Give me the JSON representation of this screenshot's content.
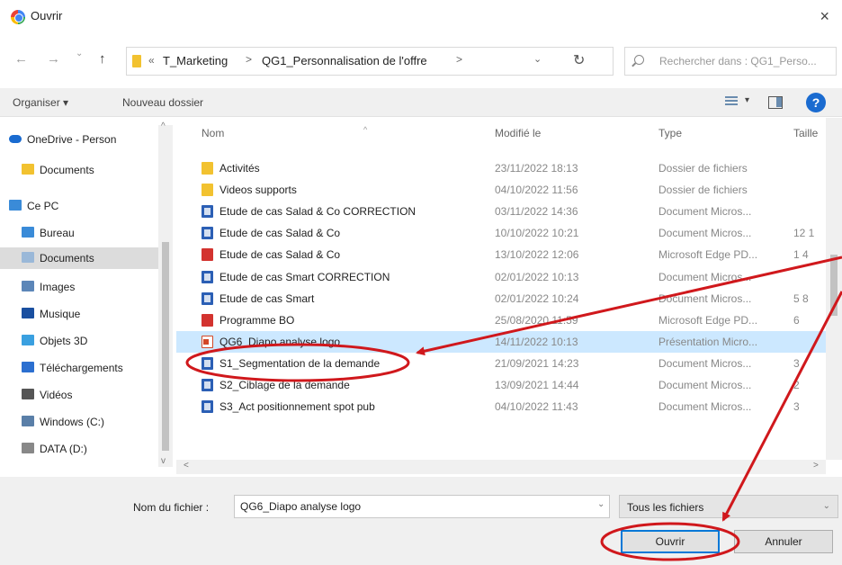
{
  "window": {
    "title": "Ouvrir",
    "close_glyph": "×"
  },
  "nav": {
    "back": "←",
    "forward": "→",
    "up": "↑",
    "breadcrumb_prefix": "«",
    "breadcrumb": [
      "T_Marketing",
      "QG1_Personnalisation de l'offre"
    ],
    "separator": ">",
    "dropdown": "⌄",
    "refresh": "↻",
    "search_placeholder": "Rechercher dans : QG1_Perso..."
  },
  "toolbar": {
    "organize": "Organiser ▾",
    "new_folder": "Nouveau dossier",
    "view_dropdown": "▾",
    "help": "?"
  },
  "sidebar": {
    "items": [
      {
        "label": "OneDrive - Person",
        "icon": "cloud-icon",
        "color": "#1a6bd0"
      },
      {
        "label": "Documents",
        "icon": "folder-icon",
        "color": "#f2c230"
      },
      {
        "label": "Ce PC",
        "icon": "computer-icon",
        "color": "#3a8bd8"
      },
      {
        "label": "Bureau",
        "icon": "desktop-icon",
        "color": "#3a8bd8"
      },
      {
        "label": "Documents",
        "icon": "documents-icon",
        "color": "#9ab8d8",
        "selected": true
      },
      {
        "label": "Images",
        "icon": "images-icon",
        "color": "#5c86b8"
      },
      {
        "label": "Musique",
        "icon": "music-icon",
        "color": "#1a4fa0"
      },
      {
        "label": "Objets 3D",
        "icon": "cube-icon",
        "color": "#3aa0e0"
      },
      {
        "label": "Téléchargements",
        "icon": "download-icon",
        "color": "#2b6fd0"
      },
      {
        "label": "Vidéos",
        "icon": "video-icon",
        "color": "#555555"
      },
      {
        "label": "Windows (C:)",
        "icon": "drive-icon",
        "color": "#5a7fa8"
      },
      {
        "label": "DATA (D:)",
        "icon": "drive-icon",
        "color": "#888888"
      }
    ]
  },
  "columns": {
    "name": "Nom",
    "modified": "Modifié le",
    "type": "Type",
    "size": "Taille"
  },
  "files": [
    {
      "name": "Activités",
      "date": "23/11/2022 18:13",
      "type": "Dossier de fichiers",
      "size": "",
      "icon": "folder"
    },
    {
      "name": "Videos supports",
      "date": "04/10/2022 11:56",
      "type": "Dossier de fichiers",
      "size": "",
      "icon": "folder"
    },
    {
      "name": "Etude de cas Salad & Co CORRECTION",
      "date": "03/11/2022 14:36",
      "type": "Document Micros...",
      "size": "",
      "icon": "word"
    },
    {
      "name": "Etude de cas Salad & Co",
      "date": "10/10/2022 10:21",
      "type": "Document Micros...",
      "size": "12 1",
      "icon": "word"
    },
    {
      "name": "Etude de cas Salad & Co",
      "date": "13/10/2022 12:06",
      "type": "Microsoft Edge PD...",
      "size": "1 4",
      "icon": "pdf"
    },
    {
      "name": "Etude de cas Smart CORRECTION",
      "date": "02/01/2022 10:13",
      "type": "Document Micros...",
      "size": "",
      "icon": "word"
    },
    {
      "name": "Etude de cas Smart",
      "date": "02/01/2022 10:24",
      "type": "Document Micros...",
      "size": "5 8",
      "icon": "word"
    },
    {
      "name": "Programme BO",
      "date": "25/08/2020 11:59",
      "type": "Microsoft Edge PD...",
      "size": "6",
      "icon": "pdf"
    },
    {
      "name": "QG6_Diapo analyse logo",
      "date": "14/11/2022 10:13",
      "type": "Présentation Micro...",
      "size": "",
      "icon": "ppt",
      "selected": true
    },
    {
      "name": "S1_Segmentation de la demande",
      "date": "21/09/2021 14:23",
      "type": "Document Micros...",
      "size": "3",
      "icon": "word"
    },
    {
      "name": "S2_Ciblage de la demande",
      "date": "13/09/2021 14:44",
      "type": "Document Micros...",
      "size": "2",
      "icon": "word"
    },
    {
      "name": "S3_Act positionnement spot pub",
      "date": "04/10/2022 11:43",
      "type": "Document Micros...",
      "size": "3",
      "icon": "word"
    }
  ],
  "footer": {
    "filename_label": "Nom du fichier :",
    "filename_value": "QG6_Diapo analyse logo",
    "filetype_value": "Tous les fichiers",
    "dropdown": "⌄",
    "open_label": "Ouvrir",
    "cancel_label": "Annuler"
  },
  "colors": {
    "selection": "#cce8ff",
    "accent": "#0078d7",
    "annotation": "#d0181c"
  }
}
